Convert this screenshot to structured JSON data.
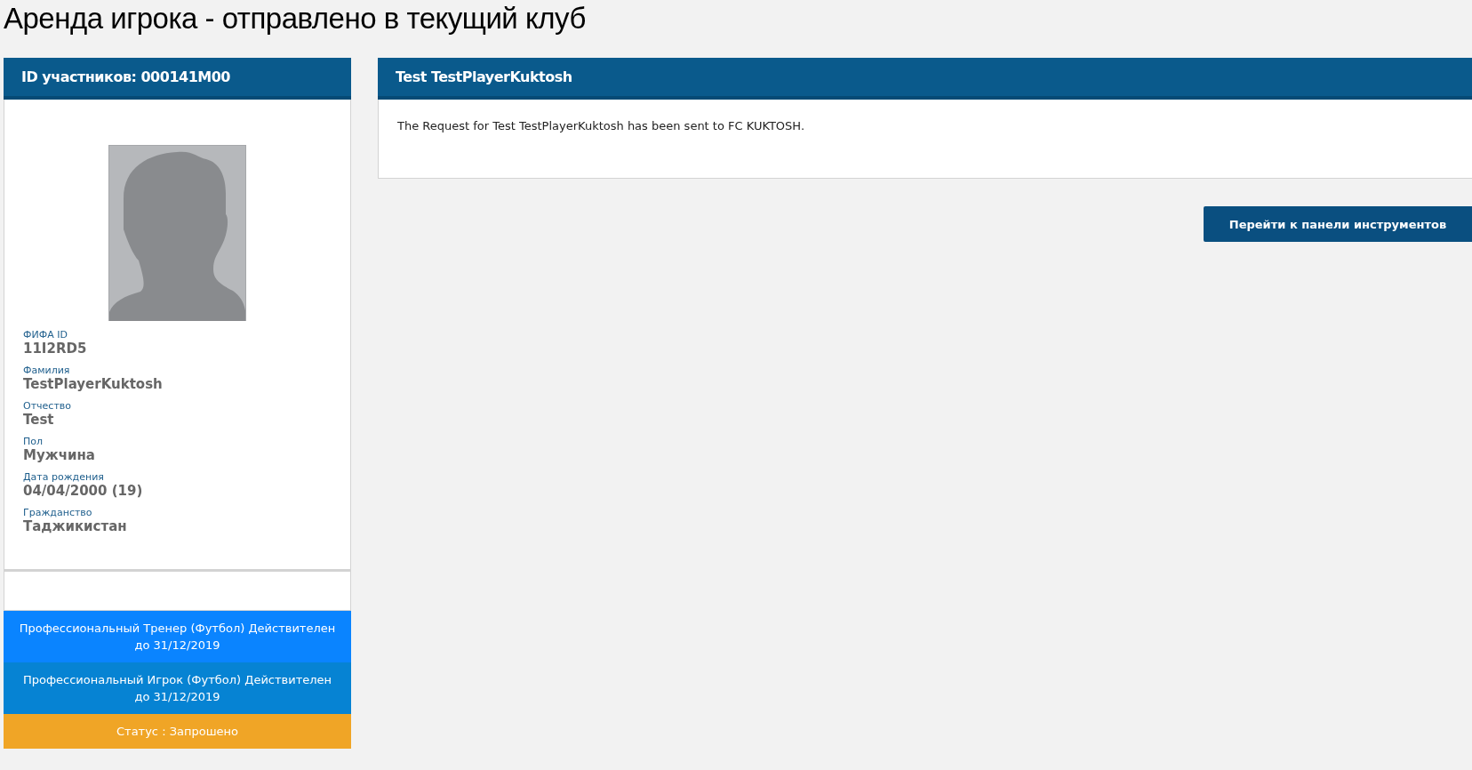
{
  "page_title": "Аренда игрока - отправлено в текущий клуб",
  "profile": {
    "header": "ID участников: 000141M00",
    "fields": [
      {
        "label": "ФИФА ID",
        "value": "11I2RD5"
      },
      {
        "label": "Фамилия",
        "value": "TestPlayerKuktosh"
      },
      {
        "label": "Отчество",
        "value": "Test"
      },
      {
        "label": "Пол",
        "value": "Мужчина"
      },
      {
        "label": "Дата рождения",
        "value": "04/04/2000 (19)"
      },
      {
        "label": "Гражданство",
        "value": "Таджикистан"
      }
    ],
    "badges": [
      {
        "text": "Профессиональный Тренер (Футбол) Действителен до 31/12/2019",
        "color": "#0a84ff"
      },
      {
        "text": "Профессиональный Игрок (Футбол) Действителен до 31/12/2019",
        "color": "#0683d3"
      },
      {
        "text": "Статус : Запрошено",
        "color": "#f0a526"
      }
    ]
  },
  "message_panel": {
    "header": "Test TestPlayerKuktosh",
    "text": "The Request for Test TestPlayerKuktosh has been sent to FC KUKTOSH."
  },
  "dashboard_button": "Перейти к панели инструментов"
}
